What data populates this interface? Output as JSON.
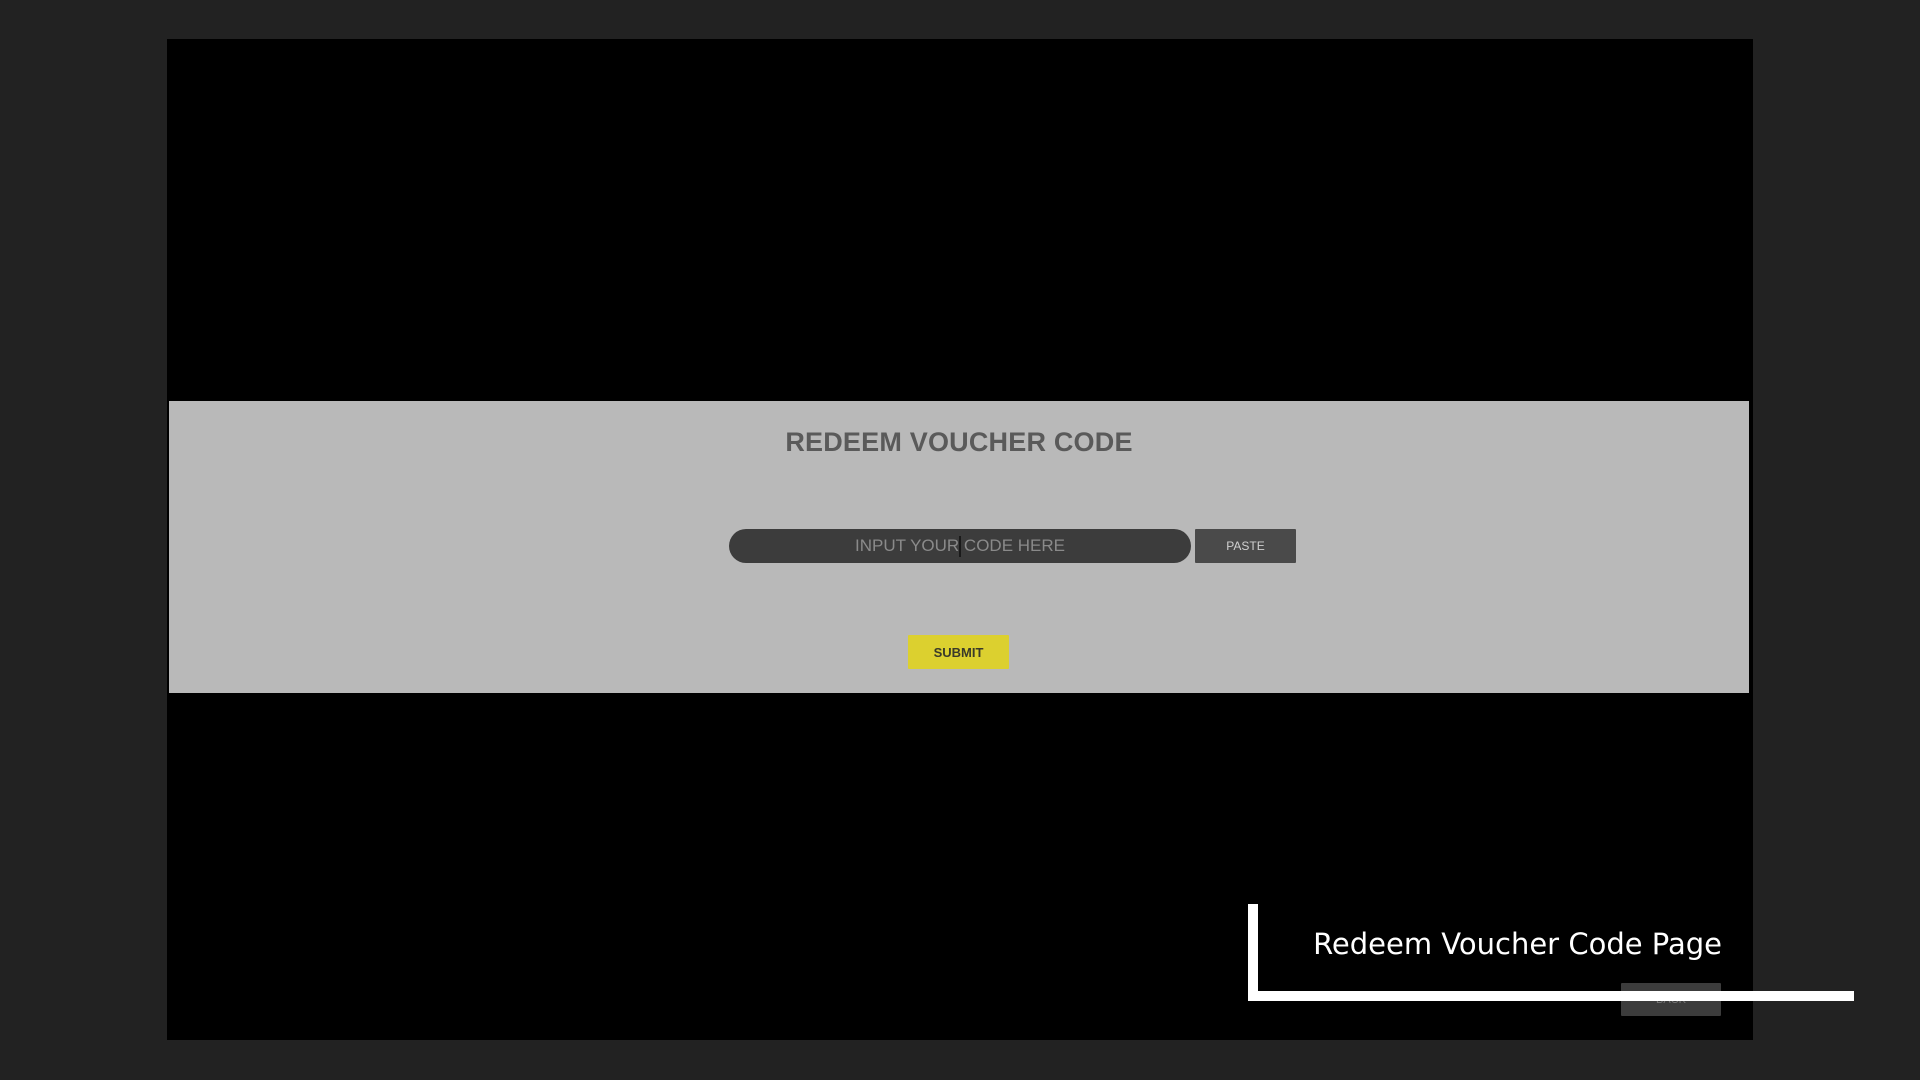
{
  "redeem_panel": {
    "title": "REDEEM VOUCHER CODE",
    "code_input": {
      "placeholder": "INPUT YOUR CODE HERE",
      "value": ""
    },
    "paste_label": "PASTE",
    "submit_label": "SUBMIT"
  },
  "footer": {
    "back_label": "BACK"
  },
  "annotation": {
    "caption": "Redeem Voucher Code Page"
  },
  "colors": {
    "background": "#222222",
    "screen": "#000000",
    "panel": "#b9b9b9",
    "input": "#3c3c3c",
    "paste_button": "#4a4a4a",
    "submit_button": "#dcd02f",
    "title_text": "#5a5a5a",
    "annotation": "#ffffff"
  }
}
